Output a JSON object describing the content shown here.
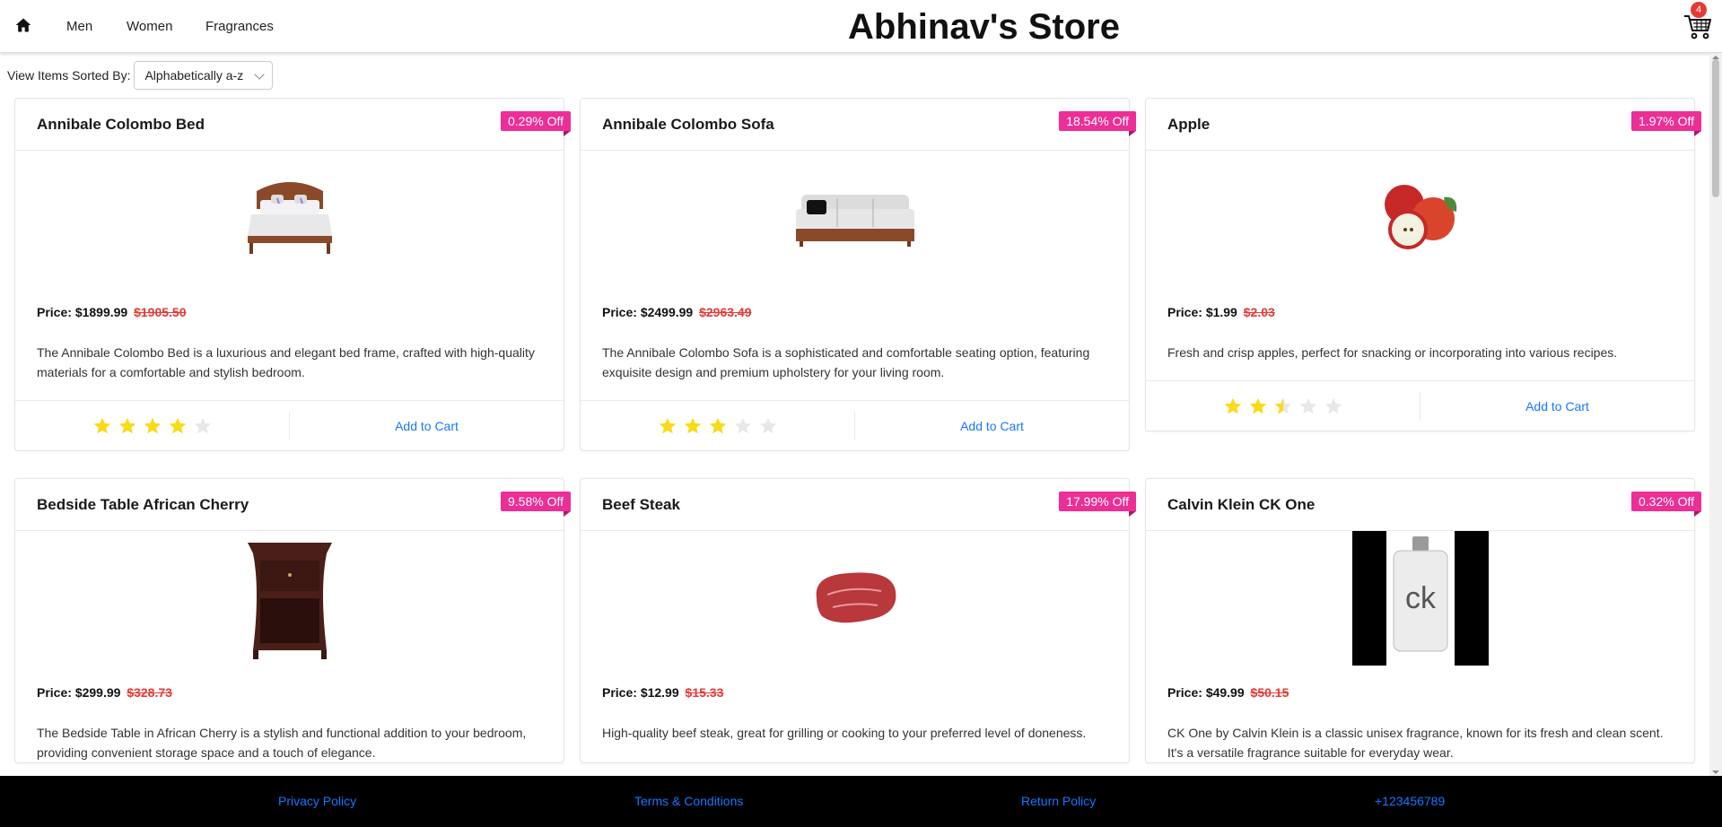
{
  "nav": {
    "links": [
      "Men",
      "Women",
      "Fragrances"
    ],
    "store_title": "Abhinav's Store",
    "cart_count": "4"
  },
  "sort": {
    "label": "View Items Sorted By:",
    "selected": "Alphabetically a-z"
  },
  "products": [
    {
      "name": "Annibale Colombo Bed",
      "discount": "0.29% Off",
      "price_prefix": "Price: ",
      "price": "$1899.99",
      "old_price": "$1905.50",
      "description": "The Annibale Colombo Bed is a luxurious and elegant bed frame, crafted with high-quality materials for a comfortable and stylish bedroom.",
      "rating": 4,
      "add_label": "Add to Cart"
    },
    {
      "name": "Annibale Colombo Sofa",
      "discount": "18.54% Off",
      "price_prefix": "Price: ",
      "price": "$2499.99",
      "old_price": "$2963.49",
      "description": "The Annibale Colombo Sofa is a sophisticated and comfortable seating option, featuring exquisite design and premium upholstery for your living room.",
      "rating": 3,
      "add_label": "Add to Cart"
    },
    {
      "name": "Apple",
      "discount": "1.97% Off",
      "price_prefix": "Price: ",
      "price": "$1.99",
      "old_price": "$2.03",
      "description": "Fresh and crisp apples, perfect for snacking or incorporating into various recipes.",
      "rating": 2.5,
      "add_label": "Add to Cart"
    },
    {
      "name": "Bedside Table African Cherry",
      "discount": "9.58% Off",
      "price_prefix": "Price: ",
      "price": "$299.99",
      "old_price": "$328.73",
      "description": "The Bedside Table in African Cherry is a stylish and functional addition to your bedroom, providing convenient storage space and a touch of elegance.",
      "rating": null,
      "add_label": ""
    },
    {
      "name": "Beef Steak",
      "discount": "17.99% Off",
      "price_prefix": "Price: ",
      "price": "$12.99",
      "old_price": "$15.33",
      "description": "High-quality beef steak, great for grilling or cooking to your preferred level of doneness.",
      "rating": null,
      "add_label": ""
    },
    {
      "name": "Calvin Klein CK One",
      "discount": "0.32% Off",
      "price_prefix": "Price: ",
      "price": "$49.99",
      "old_price": "$50.15",
      "description": "CK One by Calvin Klein is a classic unisex fragrance, known for its fresh and clean scent. It's a versatile fragrance suitable for everyday wear.",
      "rating": null,
      "add_label": ""
    }
  ],
  "footer": {
    "links": [
      "Privacy Policy",
      "Terms & Conditions",
      "Return Policy",
      "+123456789"
    ]
  },
  "colors": {
    "ribbon": "#eb2f96",
    "link": "#1677ff",
    "old_price": "#e53935",
    "star": "#fadb14",
    "badge": "#e53935"
  },
  "icons": [
    "home-icon",
    "cart-icon",
    "chevron-down-icon",
    "star-icon"
  ]
}
